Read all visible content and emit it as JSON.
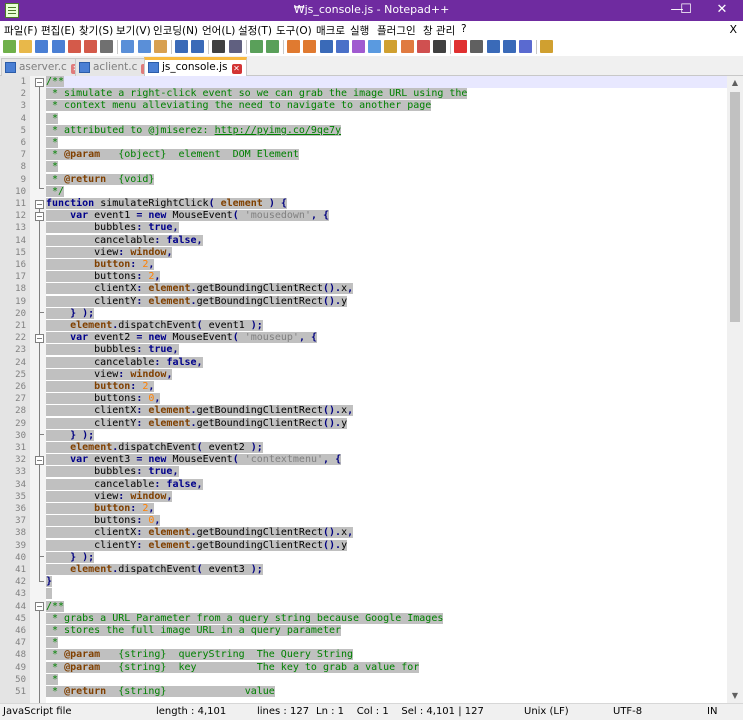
{
  "window": {
    "title": "₩js_console.js - Notepad++",
    "minimize": "—",
    "maximize": "☐",
    "close": "✕"
  },
  "menu": {
    "items": [
      "파일(F)",
      "편집(E)",
      "찾기(S)",
      "보기(V)",
      "인코딩(N)",
      "언어(L)",
      "설정(T)",
      "도구(O)",
      "매크로",
      "실행",
      "플러그인",
      "창 관리",
      "?"
    ],
    "close_doc": "X"
  },
  "toolbar": {
    "icons": [
      "new-file-icon",
      "open-file-icon",
      "save-icon",
      "save-all-icon",
      "close-icon",
      "close-all-icon",
      "print-icon",
      "cut-icon",
      "copy-icon",
      "paste-icon",
      "undo-icon",
      "redo-icon",
      "find-icon",
      "replace-icon",
      "zoom-in-icon",
      "zoom-out-icon",
      "sync-vertical-icon",
      "sync-horizontal-icon",
      "word-wrap-icon",
      "show-all-chars-icon",
      "indent-guide-icon",
      "doc-map-icon",
      "function-list-icon",
      "folder-as-workspace-icon",
      "doc-switcher-icon",
      "monitoring-icon",
      "record-macro-icon",
      "stop-macro-icon",
      "play-macro-icon",
      "run-macro-multiple-icon",
      "save-macro-icon",
      "plugin-icon"
    ]
  },
  "tabs": [
    {
      "label": "aserver.c",
      "active": false
    },
    {
      "label": "aclient.c",
      "active": false
    },
    {
      "label": "js_console.js",
      "active": true
    }
  ],
  "editor": {
    "line_numbers": [
      "1",
      "2",
      "3",
      "4",
      "5",
      "6",
      "7",
      "8",
      "9",
      "10",
      "11",
      "12",
      "13",
      "14",
      "15",
      "16",
      "17",
      "18",
      "19",
      "20",
      "21",
      "22",
      "23",
      "24",
      "25",
      "26",
      "27",
      "28",
      "29",
      "30",
      "31",
      "32",
      "33",
      "34",
      "35",
      "36",
      "37",
      "38",
      "39",
      "40",
      "41",
      "42",
      "43",
      "44",
      "45",
      "46",
      "47",
      "48",
      "49",
      "50",
      "51"
    ]
  },
  "status": {
    "language": "JavaScript file",
    "length": "length : 4,101",
    "lines": "lines : 127",
    "position": "Ln : 1    Col : 1    Sel : 4,101 | 127",
    "eol": "Unix (LF)",
    "encoding": "UTF-8",
    "mode": "IN"
  },
  "colors": {
    "titlebar": "#6f2ba0",
    "selection": "#c0c0c0",
    "comment": "#008000",
    "keyword": "#00008b",
    "string": "#808080",
    "number": "#ff8000"
  }
}
